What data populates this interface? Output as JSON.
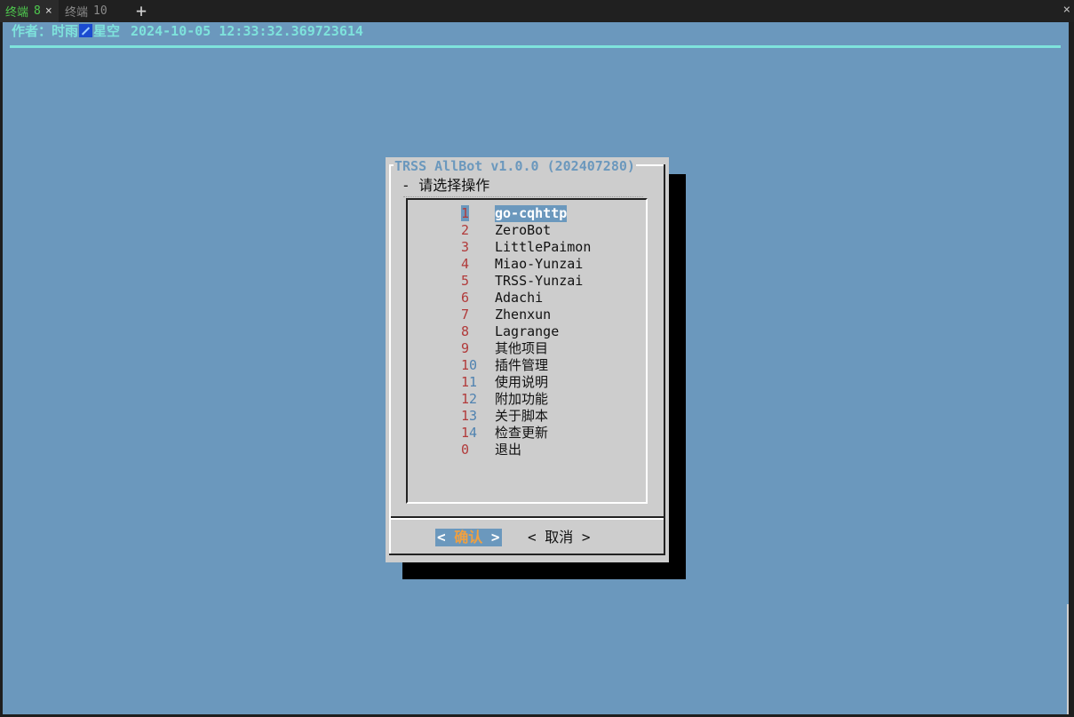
{
  "tabs": [
    {
      "label": "终端",
      "number": "8",
      "active": true
    },
    {
      "label": "终端",
      "number": "10",
      "active": false
    }
  ],
  "new_tab_label": "+",
  "close_label": "×",
  "header": {
    "author": "作者：时雨",
    "author_suffix": "星空",
    "datetime": "2024-10-05 12:33:32.369723614"
  },
  "dialog": {
    "title": "TRSS AllBot v1.0.0 (202407280)",
    "prompt": "- 请选择操作",
    "items": [
      {
        "tag": "1",
        "label": "go-cqhttp",
        "selected": true
      },
      {
        "tag": "2",
        "label": "ZeroBot"
      },
      {
        "tag": "3",
        "label": "LittlePaimon"
      },
      {
        "tag": "4",
        "label": "Miao-Yunzai"
      },
      {
        "tag": "5",
        "label": "TRSS-Yunzai"
      },
      {
        "tag": "6",
        "label": "Adachi"
      },
      {
        "tag": "7",
        "label": "Zhenxun"
      },
      {
        "tag": "8",
        "label": "Lagrange"
      },
      {
        "tag": "9",
        "label": "其他项目"
      },
      {
        "tag": "10",
        "label": "插件管理"
      },
      {
        "tag": "11",
        "label": "使用说明"
      },
      {
        "tag": "12",
        "label": "附加功能"
      },
      {
        "tag": "13",
        "label": "关于脚本"
      },
      {
        "tag": "14",
        "label": "检查更新"
      },
      {
        "tag": "0",
        "label": "退出"
      }
    ],
    "ok_button": {
      "left": "< ",
      "key": "确",
      "rest": "认",
      "right": " >"
    },
    "cancel_button": "< 取消 >"
  },
  "colors": {
    "terminal_bg": "#6b98bd",
    "dialog_bg": "#cdcdcd",
    "accent_cyan": "#7ee3dc",
    "tag_red": "#b13a3a",
    "active_tab_green": "#4ec94e"
  }
}
